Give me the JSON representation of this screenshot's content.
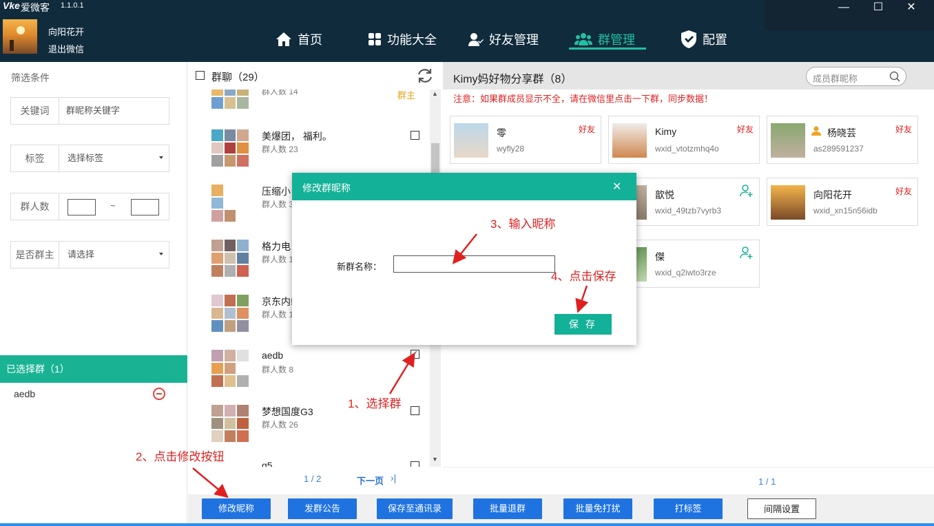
{
  "app": {
    "logo": "Vke",
    "name": "爱微客",
    "version": "1.1.0.1"
  },
  "user": {
    "name": "向阳花开",
    "logout": "退出微信"
  },
  "nav": {
    "home": "首页",
    "features": "功能大全",
    "friends": "好友管理",
    "group": "群管理",
    "config": "配置"
  },
  "window": {
    "minimize": "—",
    "maximize": "☐",
    "close": "✕"
  },
  "filter": {
    "title": "筛选条件",
    "keyword_label": "关键词",
    "keyword_placeholder": "群昵称关键字",
    "tag_label": "标签",
    "tag_value": "选择标签",
    "count_label": "群人数",
    "count_sep": "~",
    "owner_label": "是否群主",
    "owner_value": "请选择"
  },
  "selected": {
    "title": "已选择群（1）",
    "items": [
      "aedb"
    ]
  },
  "group_list": {
    "title": "群聊（29）",
    "items": [
      {
        "name": "",
        "count": "群人数 14",
        "owner": "群主",
        "checked": false
      },
      {
        "name": "美爆团，         福利。",
        "count": "群人数 23",
        "checked": false
      },
      {
        "name": "压缩小",
        "count": "群人数 3",
        "checked": false
      },
      {
        "name": "格力电",
        "count": "群人数 1",
        "checked": false
      },
      {
        "name": "京东内!",
        "count": "群人数 1",
        "checked": false
      },
      {
        "name": "aedb",
        "count": "群人数 8",
        "checked": true
      },
      {
        "name": "梦想国度G3",
        "count": "群人数 26",
        "checked": false
      },
      {
        "name": "q5",
        "count": "",
        "checked": false
      }
    ],
    "pager": {
      "page": "1 / 2",
      "next": "下一页",
      "last": "›|"
    }
  },
  "members": {
    "title": "Kimy妈好物分享群（8）",
    "search_placeholder": "成员群昵称",
    "notice": "注意：如果群成员显示不全，请在微信里点击一下群，同步数据！",
    "items": [
      {
        "name": "零",
        "wxid": "wyfly28",
        "tag": "好友"
      },
      {
        "name": "Kimy",
        "wxid": "wxid_vtotzmhq4o",
        "tag": "好友"
      },
      {
        "name": "杨晓芸",
        "wxid": "as289591237",
        "tag": "好友"
      },
      {
        "name": "歆悦",
        "wxid": "wxid_49tzb7vyrb3",
        "tag": ""
      },
      {
        "name": "向阳花开",
        "wxid": "wxid_xn15n56idb",
        "tag": "好友"
      },
      {
        "name": "傑",
        "wxid": "wxid_q2iwto3rze",
        "tag": ""
      }
    ],
    "pager": "1 / 1"
  },
  "toolbar": {
    "rename": "修改昵称",
    "notice": "发群公告",
    "save_contact": "保存至通讯录",
    "batch_quit": "批量退群",
    "batch_mute": "批量免打扰",
    "tag": "打标签",
    "interval": "间隔设置"
  },
  "modal": {
    "title": "修改群昵称",
    "label": "新群名称：",
    "save": "保 存",
    "close": "✕",
    "input_value": ""
  },
  "annotations": {
    "step1": "1、选择群",
    "step2": "2、点击修改按钮",
    "step3": "3、输入昵称",
    "step4": "4、点击保存"
  },
  "colors": {
    "header": "#0f2b3c",
    "accent": "#19b394",
    "button": "#1f73e0",
    "warning": "#e02020",
    "owner": "#e8a21a"
  }
}
